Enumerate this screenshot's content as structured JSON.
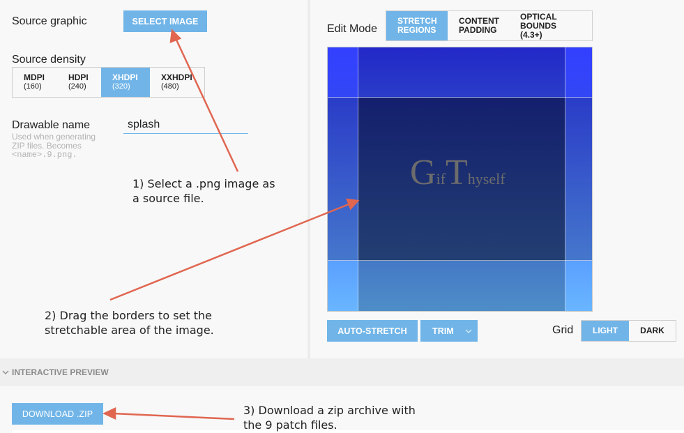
{
  "left": {
    "source_graphic_label": "Source graphic",
    "select_image_button": "SELECT IMAGE",
    "source_density_label": "Source density",
    "densities": [
      {
        "name": "MDPI",
        "value": "(160)",
        "active": false
      },
      {
        "name": "HDPI",
        "value": "(240)",
        "active": false
      },
      {
        "name": "XHDPI",
        "value": "(320)",
        "active": true
      },
      {
        "name": "XXHDPI",
        "value": "(480)",
        "active": false
      }
    ],
    "drawable_name_label": "Drawable name",
    "drawable_name_hint_line1": "Used when generating",
    "drawable_name_hint_line2": "ZIP files. Becomes",
    "drawable_name_hint_line3": "<name>.9.png.",
    "drawable_name_value": "splash"
  },
  "right": {
    "edit_mode_label": "Edit Mode",
    "edit_modes": [
      {
        "line1": "STRETCH",
        "line2": "REGIONS",
        "active": true
      },
      {
        "line1": "CONTENT",
        "line2": "PADDING",
        "active": false
      },
      {
        "line1": "OPTICAL",
        "line2": "BOUNDS (4.3+)",
        "active": false
      }
    ],
    "image_text": {
      "g": "G",
      "if": "if",
      "t": "T",
      "hyself": "hyself"
    },
    "auto_stretch_button": "AUTO-STRETCH",
    "trim_button": "TRIM",
    "grid_label": "Grid",
    "grid_options": [
      {
        "label": "LIGHT",
        "active": true
      },
      {
        "label": "DARK",
        "active": false
      }
    ]
  },
  "section": {
    "interactive_preview_label": "INTERACTIVE PREVIEW"
  },
  "download_button": "DOWNLOAD .ZIP",
  "callouts": {
    "step1_line1": "1) Select a .png image as",
    "step1_line2": "a source file.",
    "step2_line1": "2) Drag the borders to set the",
    "step2_line2": "stretchable area of the image.",
    "step3_line1": "3) Download a zip archive with",
    "step3_line2": "the 9 patch files."
  },
  "colors": {
    "accent": "#71b5e8",
    "annotation_arrow": "#e06650",
    "background": "#f8f8f8"
  },
  "icons": {
    "section_toggle": "chevron-down-icon",
    "trim_dropdown": "chevron-down-icon"
  }
}
